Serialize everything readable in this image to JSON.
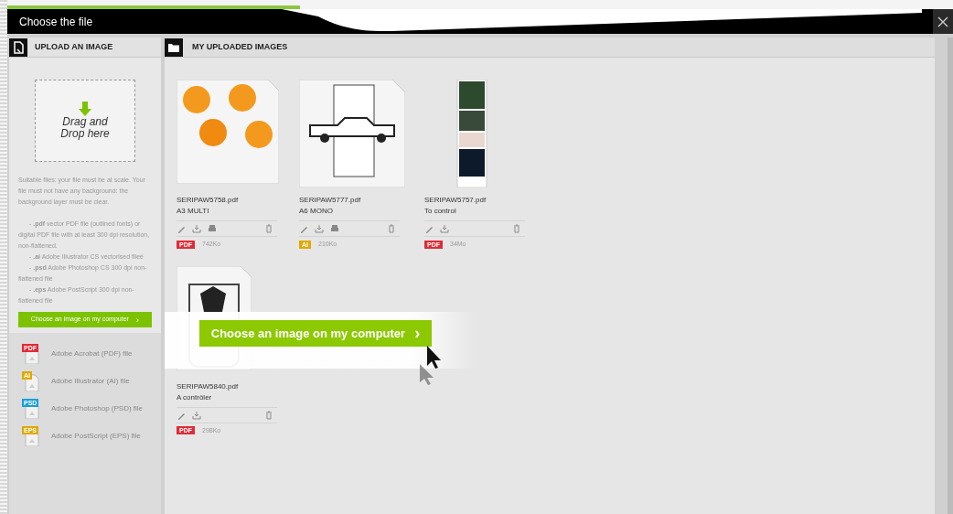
{
  "window": {
    "title": "Choose the file"
  },
  "upload_panel": {
    "title": "UPLOAD AN IMAGE",
    "drop_zone": "Drag and Drop here",
    "intro": "Suitable files: your file must be at scale. Your file must not have any background: the background layer must be clear.",
    "requirements": [
      "- **.pdf** vector PDF file (outlined fonts) or digital PDF file with at least 300 dpi resolution, non-flattened.",
      "- **.ai** Adobe Illustrator CS vectorised fileé",
      "- **.psd** Adobe Photoshop CS 300 dpi non-flattened file",
      "- **.eps** Adobe PostScript 300 dpi non-flattened file"
    ],
    "button": "Choose an image on my computer",
    "arrow": "›",
    "file_types": [
      {
        "badge": "PDF",
        "label": "Adobe Acrobat (PDF) file",
        "color": "#e02b35"
      },
      {
        "badge": "AI",
        "label": "Adobe Illustrator (AI) file",
        "color": "#e0a800"
      },
      {
        "badge": "PSD",
        "label": "Adobe Photoshop (PSD) file",
        "color": "#1a9fd6"
      },
      {
        "badge": "EPS",
        "label": "Adobe PostScript (EPS) file",
        "color": "#e0a800"
      }
    ]
  },
  "images_panel": {
    "title": "MY UPLOADED IMAGES",
    "files": [
      {
        "name": "SERIPAW5758.pdf",
        "note": "A3 MULTI",
        "kind": "splats",
        "printable": true,
        "badge": "PDF",
        "color": "#e02b35",
        "size": "742Ko"
      },
      {
        "name": "SERIPAW5777.pdf",
        "note": "A6 MONO",
        "kind": "car",
        "printable": true,
        "badge": "AI",
        "color": "#e0a800",
        "size": "210Ko"
      },
      {
        "name": "SERIPAW5757.pdf",
        "note": "To control",
        "kind": "strip",
        "printable": false,
        "badge": "PDF",
        "color": "#e02b35",
        "size": "34Mo"
      },
      {
        "name": "SERIPAW5840.pdf",
        "note": "A contrôler",
        "kind": "symbol",
        "printable": false,
        "badge": "PDF",
        "color": "#e02b35",
        "size": "298Ko"
      }
    ]
  },
  "callout": {
    "button": "Choose an image on my computer",
    "arrow": "›"
  }
}
